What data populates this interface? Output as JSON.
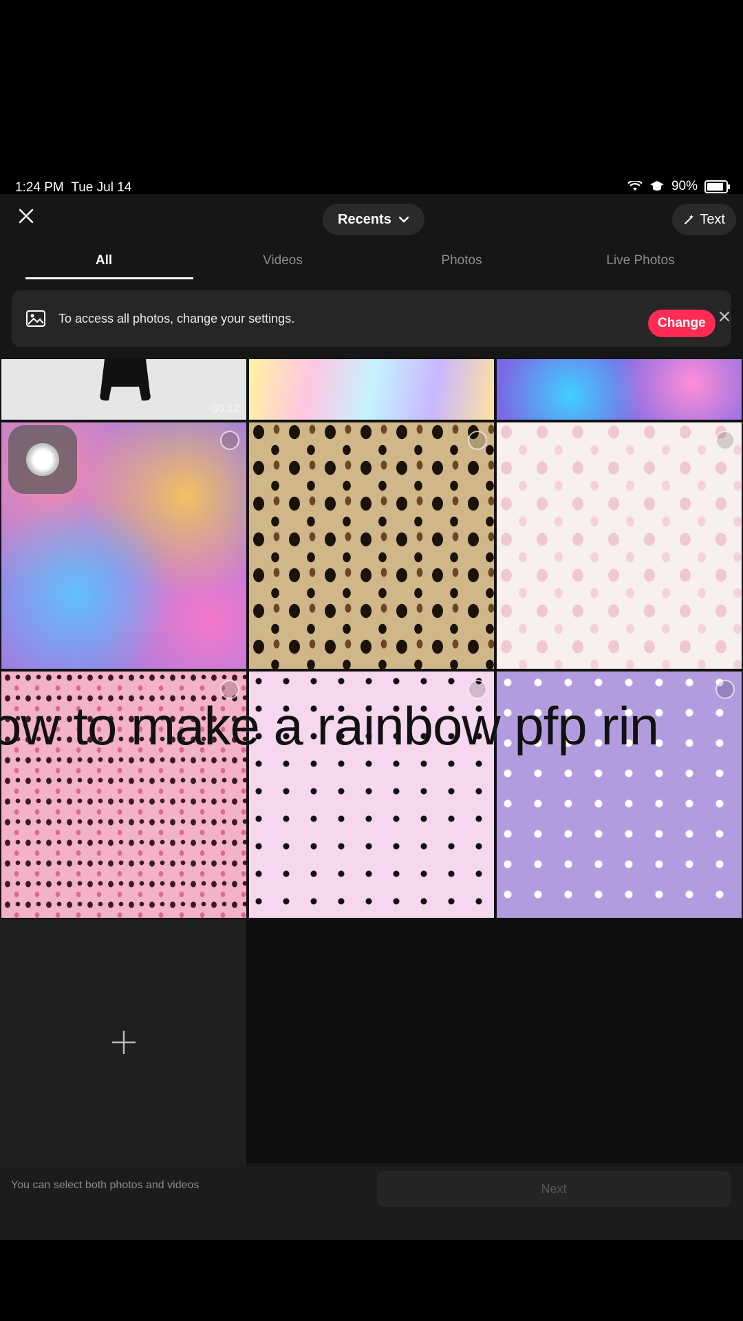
{
  "status_bar": {
    "time": "1:24 PM",
    "date": "Tue Jul 14",
    "battery": "90%",
    "battery_level": 0.9
  },
  "header": {
    "album": "Recents",
    "text_button": "Text"
  },
  "tabs": [
    {
      "label": "All",
      "active": true
    },
    {
      "label": "Videos",
      "active": false
    },
    {
      "label": "Photos",
      "active": false
    },
    {
      "label": "Live Photos",
      "active": false
    }
  ],
  "banner": {
    "message": "To access all photos, change your settings.",
    "action": "Change"
  },
  "grid": {
    "first_video_duration": "00:12"
  },
  "overlay_caption": "ow to make a rainbow pfp rin",
  "footer": {
    "hint": "You can select both photos and videos",
    "next": "Next"
  },
  "colors": {
    "accent": "#fe2c55",
    "panel": "#161616"
  }
}
